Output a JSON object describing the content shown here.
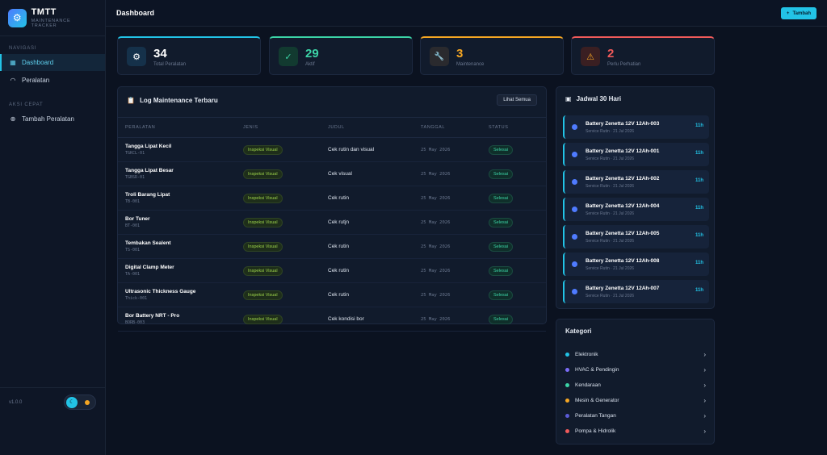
{
  "brand": {
    "title": "TMTT",
    "subtitle": "MAINTENANCE TRACKER",
    "logo_icon": "gear-icon"
  },
  "sidebar": {
    "section_nav": "NAVIGASI",
    "nav_items": [
      {
        "label": "Dashboard",
        "icon": "grid-icon",
        "active": true
      },
      {
        "label": "Peralatan",
        "icon": "wifi-icon",
        "active": false
      }
    ],
    "section_quick": "AKSI CEPAT",
    "quick_items": [
      {
        "label": "Tambah Peralatan",
        "icon": "plus-circle-icon"
      }
    ],
    "version": "v1.0.0"
  },
  "topbar": {
    "title": "Dashboard",
    "add_button": "Tambah",
    "add_icon": "+"
  },
  "stats": [
    {
      "value": "34",
      "label": "Total Peralatan",
      "color": "#22c3e6",
      "icon": "⚙"
    },
    {
      "value": "29",
      "label": "Aktif",
      "color": "#3cd3a6",
      "icon": "✓"
    },
    {
      "value": "3",
      "label": "Maintenance",
      "color": "#f5a623",
      "icon": "🔧"
    },
    {
      "value": "2",
      "label": "Perlu Perhatian",
      "color": "#f05a5a",
      "icon": "⚠"
    }
  ],
  "log": {
    "title": "Log Maintenance Terbaru",
    "see_all": "Lihat Semua",
    "columns": [
      "PERALATAN",
      "JENIS",
      "JUDUL",
      "TANGGAL",
      "STATUS"
    ],
    "rows": [
      {
        "name": "Tangga Lipat Kecil",
        "code": "TGKCL-01",
        "type": "Inspeksi Visual",
        "title": "Cek rutin dan visual",
        "date": "25 May 2026",
        "status": "Selesai"
      },
      {
        "name": "Tangga Lipat Besar",
        "code": "TGBSR-01",
        "type": "Inspeksi Visual",
        "title": "Cek visual",
        "date": "25 May 2026",
        "status": "Selesai"
      },
      {
        "name": "Troli Barang Lipat",
        "code": "TB-001",
        "type": "Inspeksi Visual",
        "title": "Cek rutin",
        "date": "25 May 2026",
        "status": "Selesai"
      },
      {
        "name": "Bor Tuner",
        "code": "BT-001",
        "type": "Inspeksi Visual",
        "title": "Cek rutjn",
        "date": "25 May 2026",
        "status": "Selesai"
      },
      {
        "name": "Tembakan Sealent",
        "code": "TS-001",
        "type": "Inspeksi Visual",
        "title": "Cek rutin",
        "date": "25 May 2026",
        "status": "Selesai"
      },
      {
        "name": "Digital Clamp Meter",
        "code": "TA-001",
        "type": "Inspeksi Visual",
        "title": "Cek rutin",
        "date": "25 May 2026",
        "status": "Selesai"
      },
      {
        "name": "Ultrasonic Thickness Gauge",
        "code": "Thick-001",
        "type": "Inspeksi Visual",
        "title": "Cek rutin",
        "date": "25 May 2026",
        "status": "Selesai"
      },
      {
        "name": "Bor Battery NRT - Pro",
        "code": "BORB-003",
        "type": "Inspeksi Visual",
        "title": "Cek kondisi bor",
        "date": "25 May 2026",
        "status": "Selesai"
      }
    ]
  },
  "schedule": {
    "title": "Jadwal 30 Hari",
    "items": [
      {
        "name": "Battery Zenetta 12V 12Ah-003",
        "sub": "Service Rutin · 21 Jul 2026",
        "badge": "11h"
      },
      {
        "name": "Battery Zenetta 12V 12Ah-001",
        "sub": "Service Rutin · 21 Jul 2026",
        "badge": "11h"
      },
      {
        "name": "Battery Zenetta 12V 12Ah-002",
        "sub": "Service Rutin · 21 Jul 2026",
        "badge": "11h"
      },
      {
        "name": "Battery Zenetta 12V 12Ah-004",
        "sub": "Service Rutin · 21 Jul 2026",
        "badge": "11h"
      },
      {
        "name": "Battery Zenetta 12V 12Ah-005",
        "sub": "Service Rutin · 21 Jul 2026",
        "badge": "11h"
      },
      {
        "name": "Battery Zenetta 12V 12Ah-008",
        "sub": "Service Rutin · 21 Jul 2026",
        "badge": "11h"
      },
      {
        "name": "Battery Zenetta 12V 12Ah-007",
        "sub": "Service Rutin · 21 Jul 2026",
        "badge": "11h"
      }
    ]
  },
  "categories": {
    "title": "Kategori",
    "items": [
      {
        "label": "Elektronik",
        "color": "#22c3e6"
      },
      {
        "label": "HVAC & Pendingin",
        "color": "#7b6cf6"
      },
      {
        "label": "Kendaraan",
        "color": "#3cd3a6"
      },
      {
        "label": "Mesin & Generator",
        "color": "#f5a623"
      },
      {
        "label": "Peralatan Tangan",
        "color": "#5b5bd6"
      },
      {
        "label": "Pompa & Hidrolik",
        "color": "#f05a5a"
      }
    ]
  }
}
